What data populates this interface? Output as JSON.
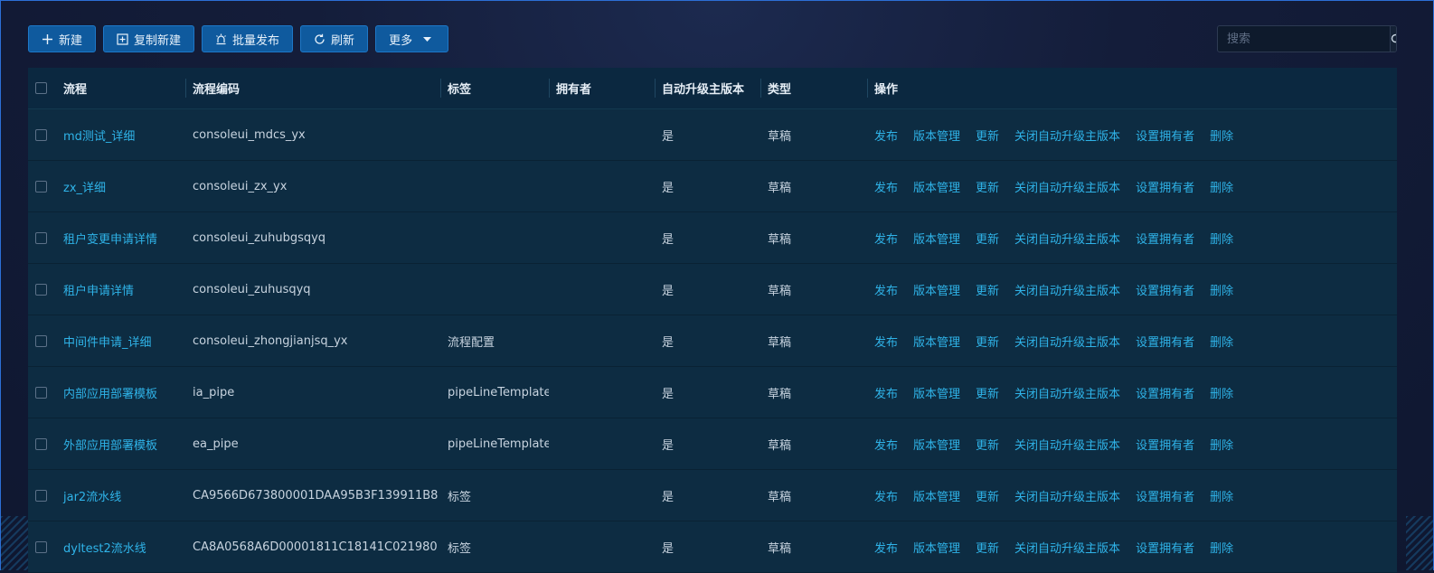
{
  "toolbar": {
    "new_label": "新建",
    "copy_new_label": "复制新建",
    "batch_publish_label": "批量发布",
    "refresh_label": "刷新",
    "more_label": "更多"
  },
  "search": {
    "placeholder": "搜索"
  },
  "table": {
    "columns": {
      "name": "流程",
      "code": "流程编码",
      "tag": "标签",
      "owner": "拥有者",
      "auto_upgrade": "自动升级主版本",
      "type": "类型",
      "ops": "操作"
    },
    "actions": {
      "publish": "发布",
      "version": "版本管理",
      "update": "更新",
      "close_auto": "关闭自动升级主版本",
      "set_owner": "设置拥有者",
      "delete": "删除"
    },
    "rows": [
      {
        "name": "md测试_详细",
        "code": "consoleui_mdcs_yx",
        "tag": "",
        "owner": "",
        "auto": "是",
        "type": "草稿"
      },
      {
        "name": "zx_详细",
        "code": "consoleui_zx_yx",
        "tag": "",
        "owner": "",
        "auto": "是",
        "type": "草稿"
      },
      {
        "name": "租户变更申请详情",
        "code": "consoleui_zuhubgsqyq",
        "tag": "",
        "owner": "",
        "auto": "是",
        "type": "草稿"
      },
      {
        "name": "租户申请详情",
        "code": "consoleui_zuhusqyq",
        "tag": "",
        "owner": "",
        "auto": "是",
        "type": "草稿"
      },
      {
        "name": "中间件申请_详细",
        "code": "consoleui_zhongjianjsq_yx",
        "tag": "流程配置",
        "owner": "",
        "auto": "是",
        "type": "草稿"
      },
      {
        "name": "内部应用部署模板",
        "code": "ia_pipe",
        "tag": "pipeLineTemplate",
        "owner": "",
        "auto": "是",
        "type": "草稿"
      },
      {
        "name": "外部应用部署模板",
        "code": "ea_pipe",
        "tag": "pipeLineTemplate",
        "owner": "",
        "auto": "是",
        "type": "草稿"
      },
      {
        "name": "jar2流水线",
        "code": "CA9566D673800001DAA95B3F139911B8",
        "tag": "标签",
        "owner": "",
        "auto": "是",
        "type": "草稿"
      },
      {
        "name": "dyltest2流水线",
        "code": "CA8A0568A6D00001811C18141C021980",
        "tag": "标签",
        "owner": "",
        "auto": "是",
        "type": "草稿"
      }
    ]
  }
}
